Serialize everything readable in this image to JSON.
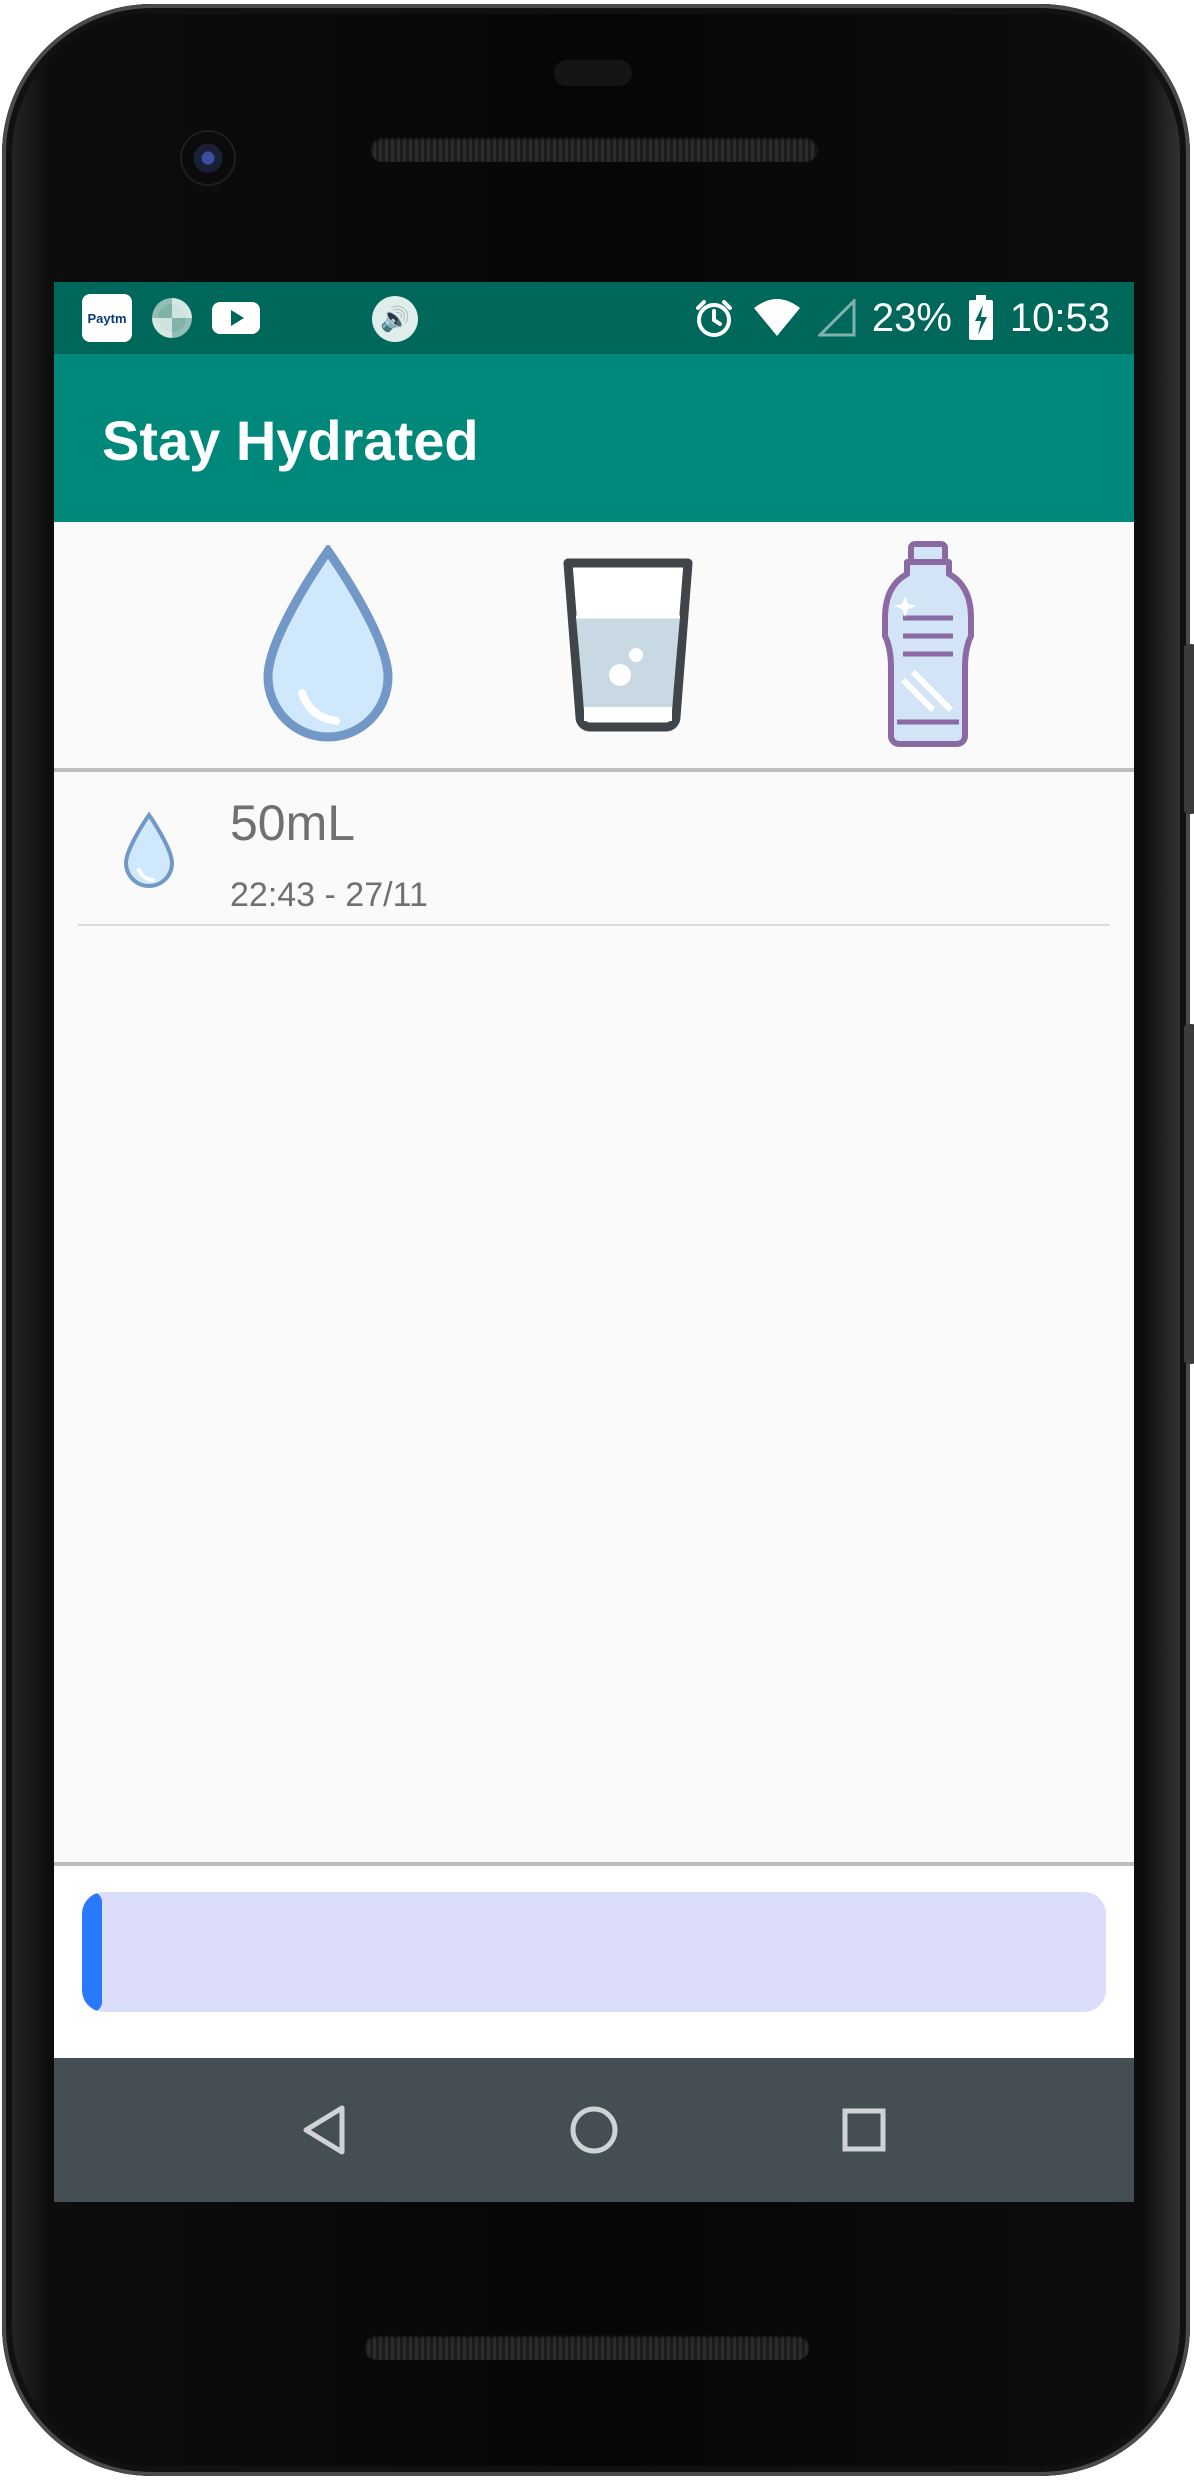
{
  "status_bar": {
    "app_icons": [
      "paytm-icon",
      "loader-icon",
      "youtube-icon",
      "volume-icon"
    ],
    "paytm_label": "Paytm",
    "battery": "23%",
    "time": "10:53",
    "system_icons": [
      "alarm-icon",
      "wifi-icon",
      "cell-signal-icon",
      "battery-charging-icon"
    ]
  },
  "app_bar": {
    "title": "Stay Hydrated"
  },
  "drink_options": [
    "water-drop-icon",
    "glass-icon",
    "bottle-icon"
  ],
  "history": [
    {
      "icon": "water-drop-icon",
      "amount": "50mL",
      "time": "22:43 - 27/11"
    }
  ],
  "progress": {
    "fraction": 0.02,
    "track_color": "#dcdcfb",
    "fill_color": "#2979ff"
  },
  "colors": {
    "status_bar": "#00675b",
    "app_bar": "#00897b",
    "nav_bar": "#454e52"
  },
  "nav": [
    "back-icon",
    "home-icon",
    "recents-icon"
  ]
}
